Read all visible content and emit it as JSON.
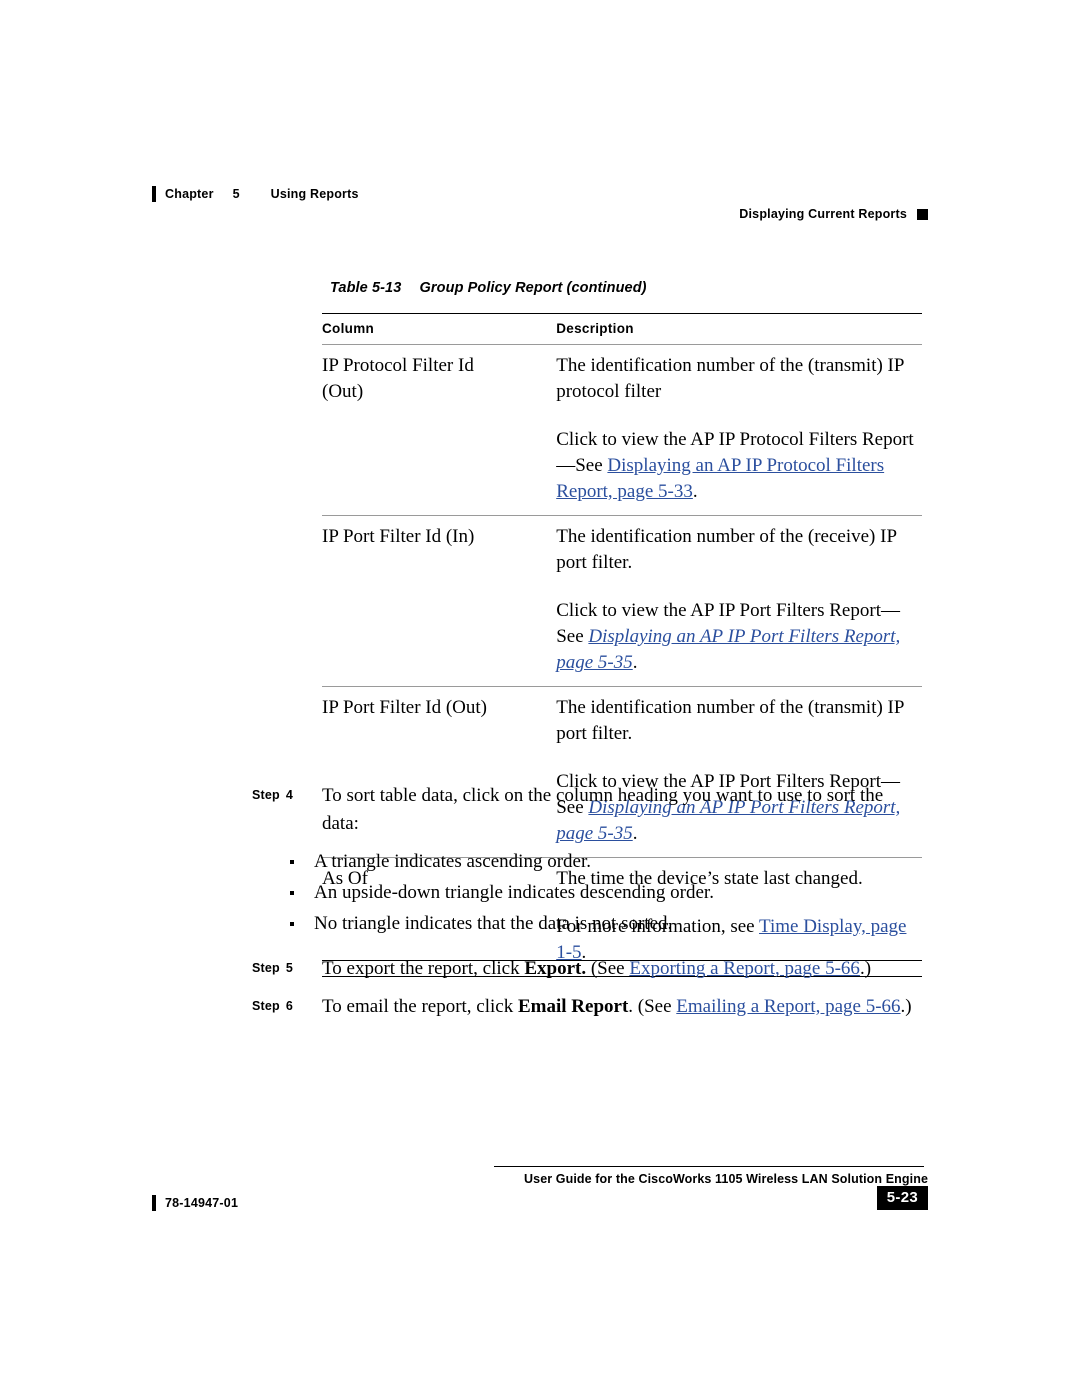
{
  "header": {
    "chapter_word": "Chapter",
    "chapter_number": "5",
    "chapter_title": "Using Reports",
    "section_title": "Displaying Current Reports"
  },
  "table": {
    "caption_number": "Table 5-13",
    "caption_text": "Group Policy Report  (continued)",
    "columns": [
      "Column",
      "Description"
    ],
    "rows": [
      {
        "column": "IP Protocol Filter Id (Out)",
        "column_line1": "IP Protocol Filter Id",
        "column_line2": "(Out)",
        "paragraphs": [
          {
            "plain": "The identification number of the (transmit) IP protocol filter"
          },
          {
            "plain_prefix": "Click to view the AP IP Protocol Filters Report—See ",
            "link": "Displaying an AP IP Protocol Filters Report, page 5-33",
            "plain_suffix": "."
          }
        ]
      },
      {
        "column": "IP Port Filter Id (In)",
        "paragraphs": [
          {
            "plain": "The identification number of the (receive) IP port filter."
          },
          {
            "plain_prefix": "Click to view the AP IP Port Filters Report—See ",
            "link": "Displaying an AP IP Port Filters Report, page 5-35",
            "plain_suffix": "."
          }
        ]
      },
      {
        "column": "IP Port Filter Id (Out)",
        "paragraphs": [
          {
            "plain": "The identification number of the (transmit) IP port filter."
          },
          {
            "plain_prefix": "Click to view the AP IP Port Filters Report—See ",
            "link": "Displaying an AP IP Port Filters Report, page 5-35",
            "plain_suffix": "."
          }
        ]
      },
      {
        "column": "As Of",
        "paragraphs": [
          {
            "plain": "The time the device’s state last changed."
          },
          {
            "plain_prefix": "For more information, see ",
            "link": "Time Display, page 1-5",
            "plain_suffix": "."
          }
        ]
      }
    ]
  },
  "steps": {
    "label_word": "Step",
    "step4": {
      "number": "4",
      "text": "To sort table data, click on the column heading you want to use to sort the data:",
      "bullets": [
        "A triangle indicates ascending order.",
        "An upside-down triangle indicates descending order.",
        "No triangle indicates that the data is not sorted."
      ]
    },
    "step5": {
      "number": "5",
      "prefix": "To export the report, click ",
      "bold": "Export.",
      "middle": " (See ",
      "link": "Exporting a Report, page 5-66",
      "suffix": ".)"
    },
    "step6": {
      "number": "6",
      "prefix": "To email the report, click ",
      "bold": "Email Report",
      "middle": ". (See ",
      "link": "Emailing a Report, page 5-66",
      "suffix": ".)"
    }
  },
  "footer": {
    "doc_title": "User Guide for the CiscoWorks 1105 Wireless LAN Solution Engine",
    "doc_number": "78-14947-01",
    "page_number": "5-23"
  },
  "colors": {
    "link": "#2b4f9e",
    "rule": "#9a9a9a",
    "text": "#000000"
  }
}
